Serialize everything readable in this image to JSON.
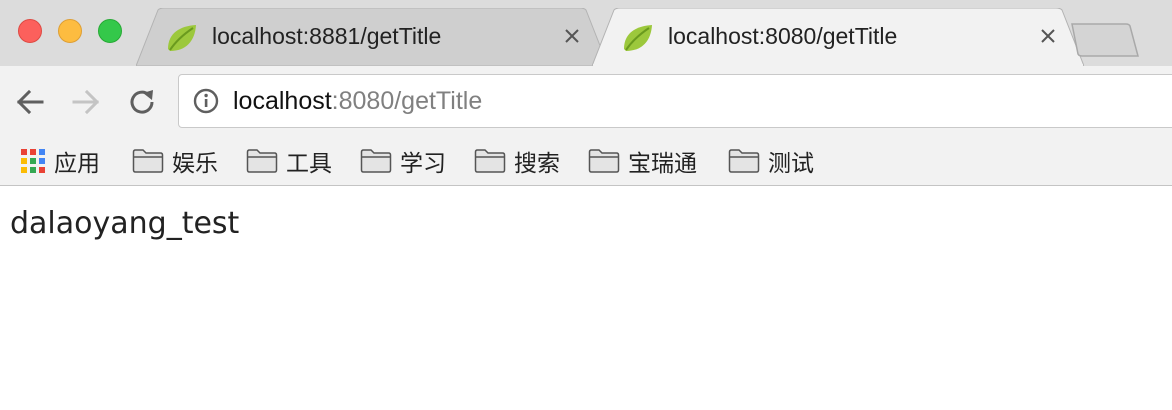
{
  "window": {
    "tabs": [
      {
        "title": "localhost:8881/getTitle",
        "active": false,
        "favicon": "spring-leaf-icon"
      },
      {
        "title": "localhost:8080/getTitle",
        "active": true,
        "favicon": "spring-leaf-icon"
      }
    ]
  },
  "toolbar": {
    "url_host": "localhost",
    "url_path": ":8080/getTitle"
  },
  "bookmarks": [
    {
      "label": "应用",
      "icon": "apps-grid-icon"
    },
    {
      "label": "娱乐",
      "icon": "folder-icon"
    },
    {
      "label": "工具",
      "icon": "folder-icon"
    },
    {
      "label": "学习",
      "icon": "folder-icon"
    },
    {
      "label": "搜索",
      "icon": "folder-icon"
    },
    {
      "label": "宝瑞通",
      "icon": "folder-icon"
    },
    {
      "label": "测试",
      "icon": "folder-icon"
    }
  ],
  "page": {
    "body_text": "dalaoyang_test"
  },
  "colors": {
    "tabstrip": "#dcdcdc",
    "toolbar": "#f2f2f2",
    "close_light": "#fc605c",
    "minimize_light": "#fdbc40",
    "maximize_light": "#34c84a",
    "spring_green": "#6db33f"
  }
}
